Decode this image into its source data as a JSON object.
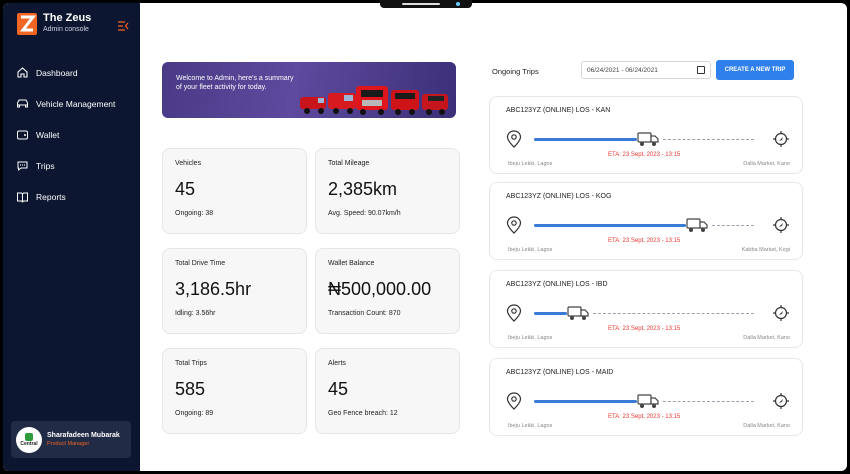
{
  "brand": {
    "title": "The Zeus",
    "subtitle": "Admin console"
  },
  "nav": [
    {
      "label": "Dashboard",
      "icon": "home-icon"
    },
    {
      "label": "Vehicle Management",
      "icon": "car-icon"
    },
    {
      "label": "Wallet",
      "icon": "wallet-icon"
    },
    {
      "label": "Trips",
      "icon": "chat-icon"
    },
    {
      "label": "Reports",
      "icon": "book-icon"
    }
  ],
  "user": {
    "name": "Sharafadeen Mubarak",
    "role": "Product Manager",
    "avatar_text": "Central"
  },
  "banner": {
    "text": "Welcome to Admin, here's a summary of your fleet activity for today."
  },
  "stats": {
    "vehicles": {
      "label": "Vehicles",
      "value": "45",
      "sub": "Ongoing: 38"
    },
    "mileage": {
      "label": "Total Mileage",
      "value": "2,385km",
      "sub": "Avg. Speed: 90.07km/h"
    },
    "drive_time": {
      "label": "Total Drive Time",
      "value": "3,186.5hr",
      "sub": "Idling: 3.56hr"
    },
    "wallet": {
      "label": "Wallet Balance",
      "value": "₦500,000.00",
      "sub": "Transaction Count: 870"
    },
    "trips": {
      "label": "Total Trips",
      "value": "585",
      "sub": "Ongoing: 89"
    },
    "alerts": {
      "label": "Alerts",
      "value": "45",
      "sub": "Geo Fence breach: 12"
    }
  },
  "ongoing": {
    "title": "Ongoing Trips",
    "date_range": "06/24/2021 - 06/24/2021",
    "create_button": "CREATE A NEW TRIP"
  },
  "trip_list": [
    {
      "title": "ABC123YZ (ONLINE) LOS - KAN",
      "eta": "ETA: 23 Sept, 2023 - 13:15",
      "from": "Ibeju Lekki, Lagos",
      "to": "Dalla Market, Kano",
      "progress": 0.52
    },
    {
      "title": "ABC123YZ (ONLINE) LOS - KOG",
      "eta": "ETA: 23 Sept, 2023 - 13:15",
      "from": "Ibeju Lekki, Lagos",
      "to": "Kabba Market, Kogi",
      "progress": 0.74
    },
    {
      "title": "ABC123YZ (ONLINE) LOS - IBD",
      "eta": "ETA: 23 Sept, 2023 - 13:15",
      "from": "Ibeju Lekki, Lagos",
      "to": "Dalla Market, Kano",
      "progress": 0.2
    },
    {
      "title": "ABC123YZ (ONLINE) LOS - MAID",
      "eta": "ETA: 23 Sept, 2023 - 13:15",
      "from": "Ibeju Lekki, Lagos",
      "to": "Dalla Market, Kano",
      "progress": 0.52
    }
  ],
  "colors": {
    "sidebar": "#0d1630",
    "accent": "#2f80ed",
    "brand_orange": "#f26522",
    "eta": "#e53935"
  }
}
